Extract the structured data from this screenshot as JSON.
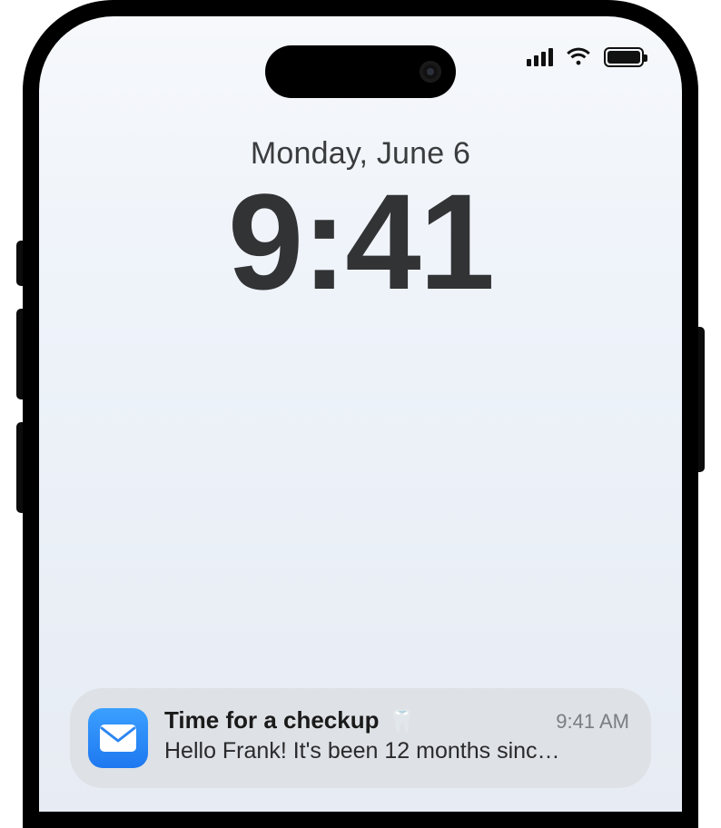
{
  "lockscreen": {
    "date": "Monday, June 6",
    "time": "9:41"
  },
  "status": {
    "signal_bars": 4,
    "wifi": true,
    "battery_full": true
  },
  "notification": {
    "app": "Mail",
    "title": "Time for a checkup",
    "emoji": "🦷",
    "timestamp": "9:41 AM",
    "preview": "Hello Frank! It's been 12 months sinc…"
  }
}
